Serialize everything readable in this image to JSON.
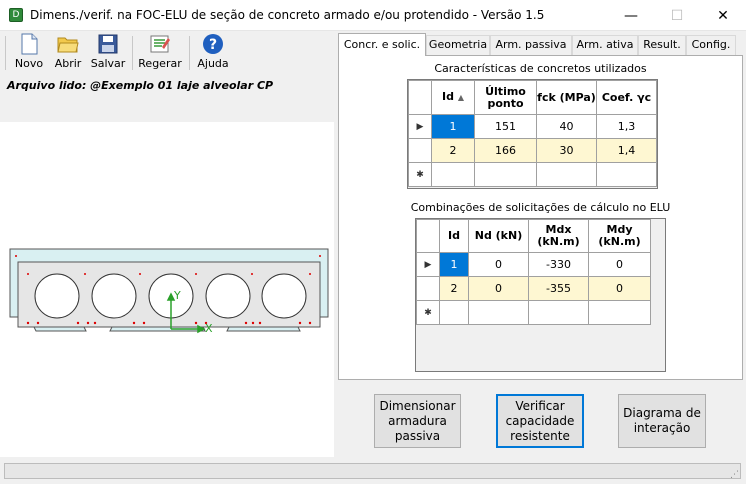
{
  "window": {
    "title": "Dimens./verif. na FOC-ELU de seção de concreto armado e/ou protendido - Versão 1.5",
    "minimize": "—",
    "maximize": "☐",
    "close": "✕"
  },
  "toolbar": {
    "new": "Novo",
    "open": "Abrir",
    "save": "Salvar",
    "regen": "Regerar",
    "help": "Ajuda"
  },
  "file_label": "Arquivo lido: @Exemplo 01 laje alveolar CP",
  "tabs": [
    "Concr. e solic.",
    "Geometria",
    "Arm. passiva",
    "Arm. ativa",
    "Result.",
    "Config."
  ],
  "concrete": {
    "title": "Características de concretos utilizados",
    "headers": [
      "Id",
      "Último ponto",
      "fck (MPa)",
      "Coef. γc"
    ],
    "rows": [
      [
        "1",
        "151",
        "40",
        "1,3"
      ],
      [
        "2",
        "166",
        "30",
        "1,4"
      ]
    ]
  },
  "loads": {
    "title": "Combinações de solicitações de cálculo no ELU",
    "headers": [
      "Id",
      "Nd (kN)",
      "Mdx (kN.m)",
      "Mdy (kN.m)"
    ],
    "rows": [
      [
        "1",
        "0",
        "-330",
        "0"
      ],
      [
        "2",
        "0",
        "-355",
        "0"
      ]
    ]
  },
  "buttons": {
    "design": "Dimensionar armadura passiva",
    "verify": "Verificar capacidade resistente",
    "diagram": "Diagrama de interação"
  },
  "axes": {
    "x": "X",
    "y": "Y"
  },
  "colors": {
    "accent": "#0078d7",
    "row_alt": "#fef7d2",
    "slab": "#d9f0f2"
  }
}
